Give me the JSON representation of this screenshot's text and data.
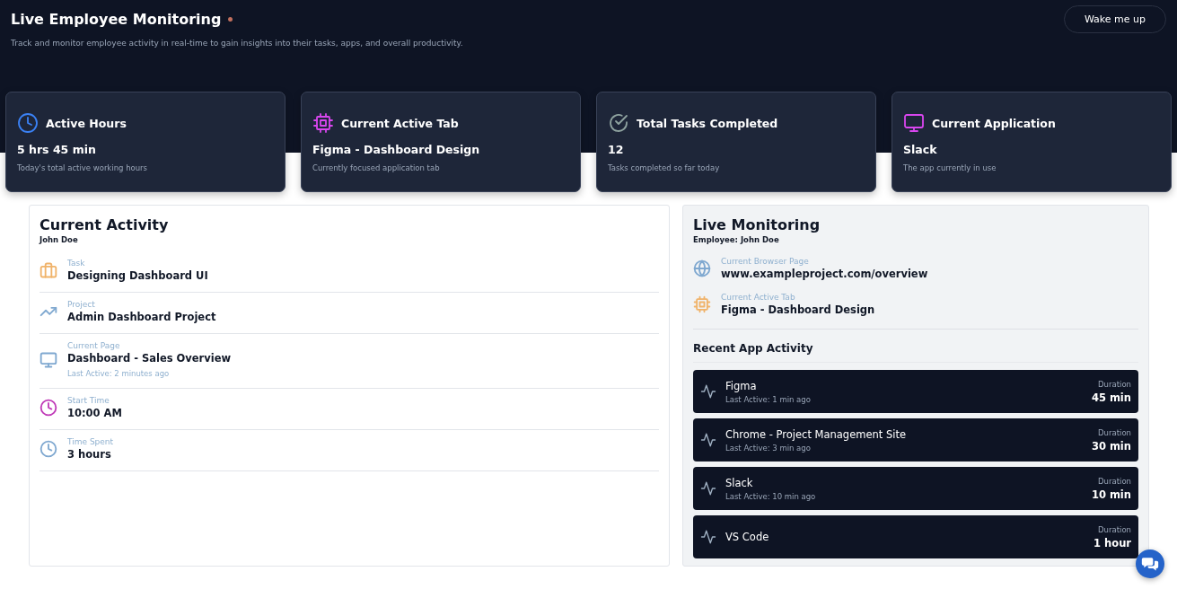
{
  "header": {
    "title": "Live Employee Monitoring",
    "subtitle": "Track and monitor employee activity in real-time to gain insights into their tasks, apps, and overall productivity.",
    "button": "Wake me up"
  },
  "stats": [
    {
      "kind": "clock",
      "color": "#3b82f6",
      "title": "Active Hours",
      "value": "5 hrs 45 min",
      "caption": "Today's total active working hours"
    },
    {
      "kind": "chip",
      "color": "#d946ef",
      "title": "Current Active Tab",
      "value": "Figma - Dashboard Design",
      "caption": "Currently focused application tab"
    },
    {
      "kind": "check",
      "color": "#8fa3a0",
      "title": "Total Tasks Completed",
      "value": "12",
      "caption": "Tasks completed so far today"
    },
    {
      "kind": "monitor",
      "color": "#d946ef",
      "title": "Current Application",
      "value": "Slack",
      "caption": "The app currently in use"
    }
  ],
  "current_activity": {
    "title": "Current Activity",
    "employee": "John Doe",
    "items": [
      {
        "kind": "briefcase",
        "color": "#f0b36a",
        "label": "Task",
        "value": "Designing Dashboard UI"
      },
      {
        "kind": "trend",
        "color": "#7fa8d0",
        "label": "Project",
        "value": "Admin Dashboard Project"
      },
      {
        "kind": "monitor",
        "color": "#7fa8d0",
        "label": "Current Page",
        "value": "Dashboard - Sales Overview",
        "note": "Last Active: 2 minutes ago"
      },
      {
        "kind": "clock",
        "color": "#c03bb8",
        "label": "Start Time",
        "value": "10:00 AM"
      },
      {
        "kind": "clock",
        "color": "#7fa8d0",
        "label": "Time Spent",
        "value": "3 hours"
      }
    ]
  },
  "live_monitoring": {
    "title": "Live Monitoring",
    "employee": "Employee: John Doe",
    "items": [
      {
        "kind": "globe",
        "color": "#7fa8d0",
        "label": "Current Browser Page",
        "value": "www.exampleproject.com/overview"
      },
      {
        "kind": "chip",
        "color": "#f0b36a",
        "label": "Current Active Tab",
        "value": "Figma - Dashboard Design"
      }
    ],
    "recent_title": "Recent App Activity",
    "apps": [
      {
        "name": "Figma",
        "last_active": "Last Active: 1 min ago",
        "duration_label": "Duration",
        "duration": "45 min"
      },
      {
        "name": "Chrome - Project Management Site",
        "last_active": "Last Active: 3 min ago",
        "duration_label": "Duration",
        "duration": "30 min"
      },
      {
        "name": "Slack",
        "last_active": "Last Active: 10 min ago",
        "duration_label": "Duration",
        "duration": "10 min"
      },
      {
        "name": "VS Code",
        "duration_label": "Duration",
        "duration": "1 hour"
      }
    ]
  }
}
